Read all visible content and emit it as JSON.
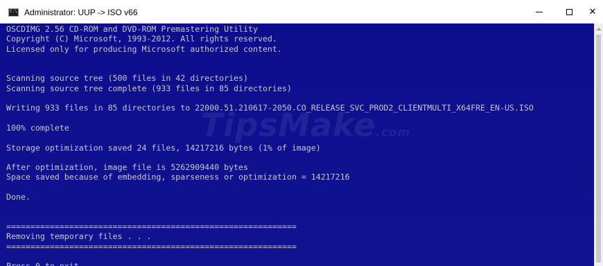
{
  "window": {
    "title": "Administrator:  UUP -> ISO v66",
    "icon": "console-icon",
    "controls": {
      "minimize_icon": "minimize-icon",
      "maximize_icon": "maximize-icon",
      "close_glyph": "✕"
    }
  },
  "console": {
    "background_color": "#0e0f8f",
    "text_color": "#c8c8c8",
    "lines": [
      "OSCDIMG 2.56 CD-ROM and DVD-ROM Premastering Utility",
      "Copyright (C) Microsoft, 1993-2012. All rights reserved.",
      "Licensed only for producing Microsoft authorized content.",
      "",
      "",
      "Scanning source tree (500 files in 42 directories)",
      "Scanning source tree complete (933 files in 85 directories)",
      "",
      "Writing 933 files in 85 directories to 22000.51.210617-2050.CO_RELEASE_SVC_PROD2_CLIENTMULTI_X64FRE_EN-US.ISO",
      "",
      "100% complete",
      "",
      "Storage optimization saved 24 files, 14217216 bytes (1% of image)",
      "",
      "After optimization, image file is 5262909440 bytes",
      "Space saved because of embedding, sparseness or optimization = 14217216",
      "",
      "Done.",
      "",
      "",
      "============================================================",
      "Removing temporary files . . .",
      "============================================================",
      "",
      "Press 0 to exit."
    ]
  },
  "watermark": {
    "text": "TipsMake",
    "suffix": ".com"
  }
}
